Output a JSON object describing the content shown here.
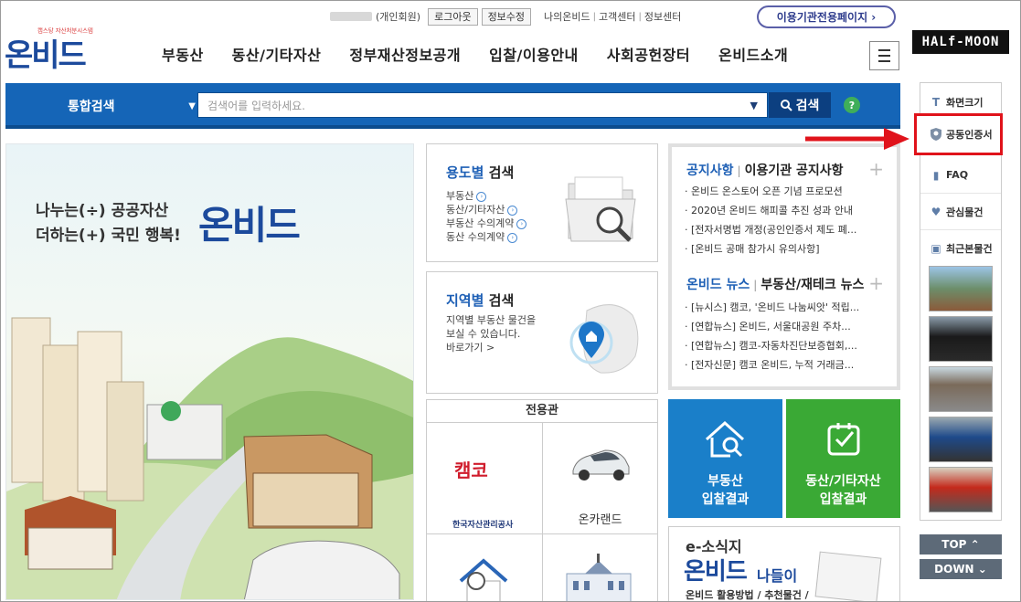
{
  "header": {
    "user_member_type": "(개인회원)",
    "logout_label": "로그아웃",
    "edit_info_label": "정보수정",
    "util_links": [
      "나의온비드",
      "고객센터",
      "정보센터"
    ],
    "institution_page_label": "이용기관전용페이지 ›",
    "halfmoon_label": "HALf-MOON",
    "logo_tagline": "캠스탕 자산처분시스템",
    "logo_text": "온비드"
  },
  "nav": {
    "items": [
      "부동산",
      "동산/기타자산",
      "정부재산정보공개",
      "입찰/이용안내",
      "사회공헌장터",
      "온비드소개"
    ]
  },
  "search": {
    "category_label": "통합검색",
    "placeholder": "검색어를 입력하세요.",
    "button_label": "검색",
    "help_label": "?"
  },
  "hero": {
    "line1": "나누는(÷) 공공자산",
    "line2": "더하는(+) 국민 행복!",
    "brand": "온비드"
  },
  "usage_search": {
    "title_colored": "용도별",
    "title_rest": "검색",
    "links": [
      "부동산",
      "동산/기타자산",
      "부동산 수의계약",
      "동산 수의계약"
    ]
  },
  "region_search": {
    "title_colored": "지역별",
    "title_rest": "검색",
    "desc_line1": "지역별 부동산 물건을",
    "desc_line2": "보실 수 있습니다.",
    "link": "바로가기 >"
  },
  "exclusive": {
    "title": "전용관",
    "kamco_logo": "캠코",
    "kamco_name": "한국자산관리공사",
    "oncarland": "온카랜드"
  },
  "notice": {
    "tab1": "공지사항",
    "tab2": "이용기관 공지사항",
    "items": [
      "· 온비드 온스토어 오픈 기념 프로모션",
      "· 2020년 온비드 해피콜 추진 성과 안내",
      "· [전자서명법 개정(공인인증서 제도 폐...",
      "· [온비드 공매 참가시 유의사항]"
    ],
    "news_tab1": "온비드 뉴스",
    "news_tab2": "부동산/재테크 뉴스",
    "news_items": [
      "· [뉴시스] 캠코, '온비드 나눔씨앗' 적립...",
      "· [연합뉴스] 온비드, 서울대공원 주차...",
      "· [연합뉴스] 캠코-자동차진단보증협회,...",
      "· [전자신문] 캠코 온비드, 누적 거래금..."
    ]
  },
  "results": {
    "realestate": [
      "부동산",
      "입찰결과"
    ],
    "movable": [
      "동산/기타자산",
      "입찰결과"
    ]
  },
  "esosik": {
    "prefix": "e-소식지",
    "brand": "온비드",
    "suffix": "나들이",
    "sub": "온비드 활용방법 / 추천물건 /"
  },
  "sidebar": {
    "screen_size": "화면크기",
    "cert": "공동인증서",
    "faq": "FAQ",
    "favorites": "관심물건",
    "recent": "최근본물건",
    "top": "TOP ⌃",
    "down": "DOWN ⌄"
  },
  "colors": {
    "primary": "#1565b7",
    "dark": "#0c3f80",
    "tile_blue": "#1a7fc9",
    "tile_green": "#3aa935",
    "highlight": "#e0131b"
  }
}
